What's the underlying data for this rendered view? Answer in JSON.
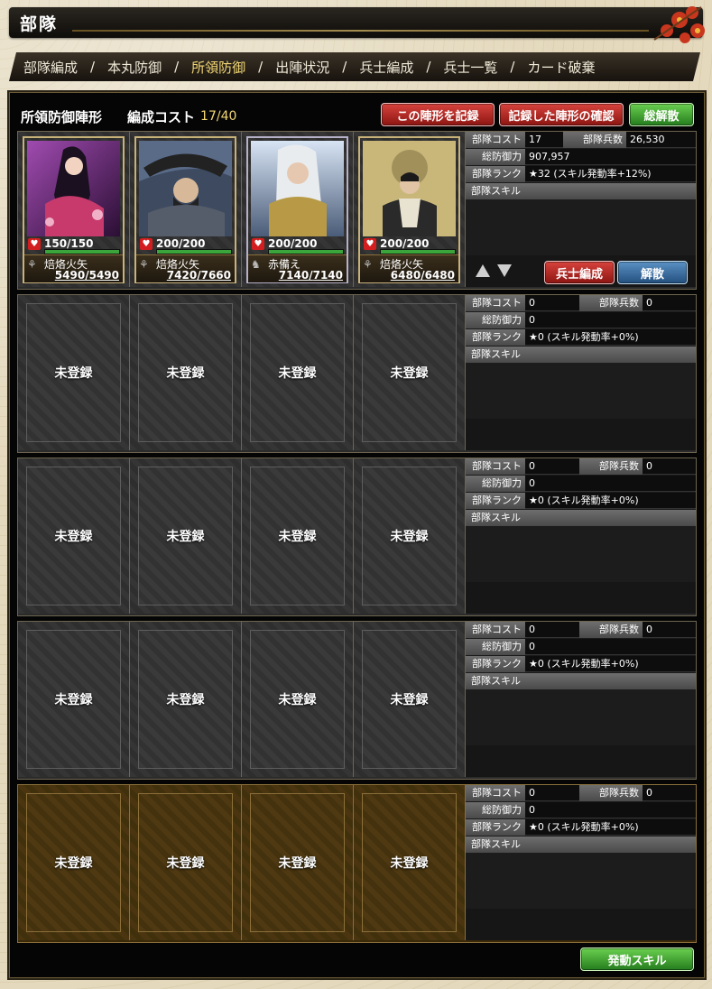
{
  "window": {
    "title": "部隊"
  },
  "tabs": [
    {
      "label": "部隊編成",
      "active": false
    },
    {
      "label": "本丸防御",
      "active": false
    },
    {
      "label": "所領防御",
      "active": true
    },
    {
      "label": "出陣状況",
      "active": false
    },
    {
      "label": "兵士編成",
      "active": false
    },
    {
      "label": "兵士一覧",
      "active": false
    },
    {
      "label": "カード破棄",
      "active": false
    }
  ],
  "header": {
    "title": "所領防御陣形",
    "cost_label": "編成コスト",
    "cost_value": "17/40",
    "btn_record": "この陣形を記録",
    "btn_confirm": "記録した陣形の確認",
    "btn_disband_all": "総解散"
  },
  "labels": {
    "cost": "部隊コスト",
    "soldiers": "部隊兵数",
    "defense": "総防御力",
    "rank": "部隊ランク",
    "skill": "部隊スキル",
    "empty": "未登録"
  },
  "squads": [
    {
      "cost": "17",
      "soldiers": "26,530",
      "defense": "907,957",
      "rank": "★32 (スキル発動率+12%)",
      "cards": [
        {
          "hp": "150/150",
          "unit": "焙烙火矢",
          "count_cur": "5490",
          "count_max": "5490"
        },
        {
          "hp": "200/200",
          "unit": "焙烙火矢",
          "count_cur": "7420",
          "count_max": "7660"
        },
        {
          "hp": "200/200",
          "unit": "赤備え",
          "count_cur": "7140",
          "count_max": "7140"
        },
        {
          "hp": "200/200",
          "unit": "焙烙火矢",
          "count_cur": "6480",
          "count_max": "6480"
        }
      ],
      "btn_soldiers": "兵士編成",
      "btn_disband": "解散"
    },
    {
      "cost": "0",
      "soldiers": "0",
      "defense": "0",
      "rank": "★0 (スキル発動率+0%)"
    },
    {
      "cost": "0",
      "soldiers": "0",
      "defense": "0",
      "rank": "★0 (スキル発動率+0%)"
    },
    {
      "cost": "0",
      "soldiers": "0",
      "defense": "0",
      "rank": "★0 (スキル発動率+0%)"
    },
    {
      "cost": "0",
      "soldiers": "0",
      "defense": "0",
      "rank": "★0 (スキル発動率+0%)"
    }
  ],
  "footer": {
    "btn_skill": "発動スキル"
  },
  "colors": {
    "accent_gold": "#f2d774",
    "button_red": "#b52420",
    "button_green": "#3fa22f",
    "button_blue": "#33689c"
  },
  "icons": [
    "heart-icon",
    "unit-type-icon",
    "arrow-up-icon",
    "arrow-down-icon",
    "flower-icon"
  ]
}
